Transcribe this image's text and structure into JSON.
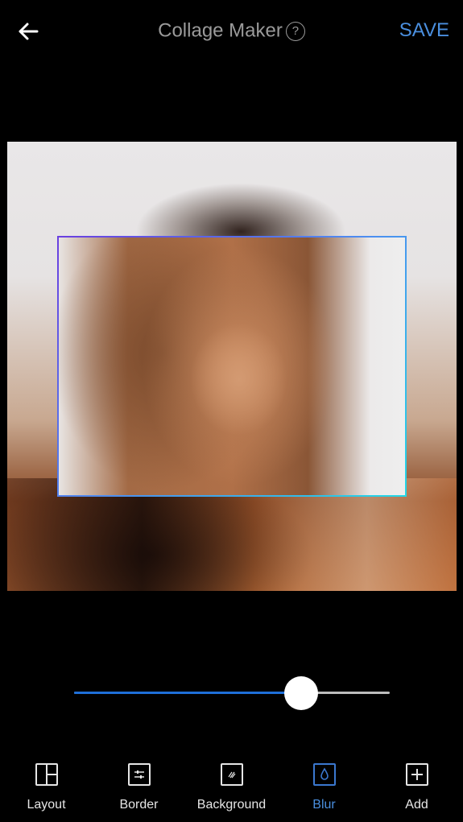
{
  "header": {
    "back_icon": "arrow-left-icon",
    "title": "Collage Maker",
    "help_icon": "question-circle-icon",
    "help_label": "?",
    "save_label": "SAVE"
  },
  "colors": {
    "accent": "#4a8fdf",
    "slider_fill": "#1e6fd9",
    "frame_gradient_start": "#6a3fe0",
    "frame_gradient_end": "#22d8e6",
    "background": "#000000"
  },
  "canvas": {
    "photo_description": "portrait of woman with brown hair, blurred background"
  },
  "blur_slider": {
    "value": 0.72
  },
  "toolbar": {
    "items": [
      {
        "label": "Layout",
        "icon": "layout-grid-icon",
        "active": false
      },
      {
        "label": "Border",
        "icon": "sliders-icon",
        "active": false
      },
      {
        "label": "Background",
        "icon": "pattern-icon",
        "active": false
      },
      {
        "label": "Blur",
        "icon": "droplet-icon",
        "active": true
      },
      {
        "label": "Add",
        "icon": "plus-square-icon",
        "active": false
      }
    ]
  }
}
